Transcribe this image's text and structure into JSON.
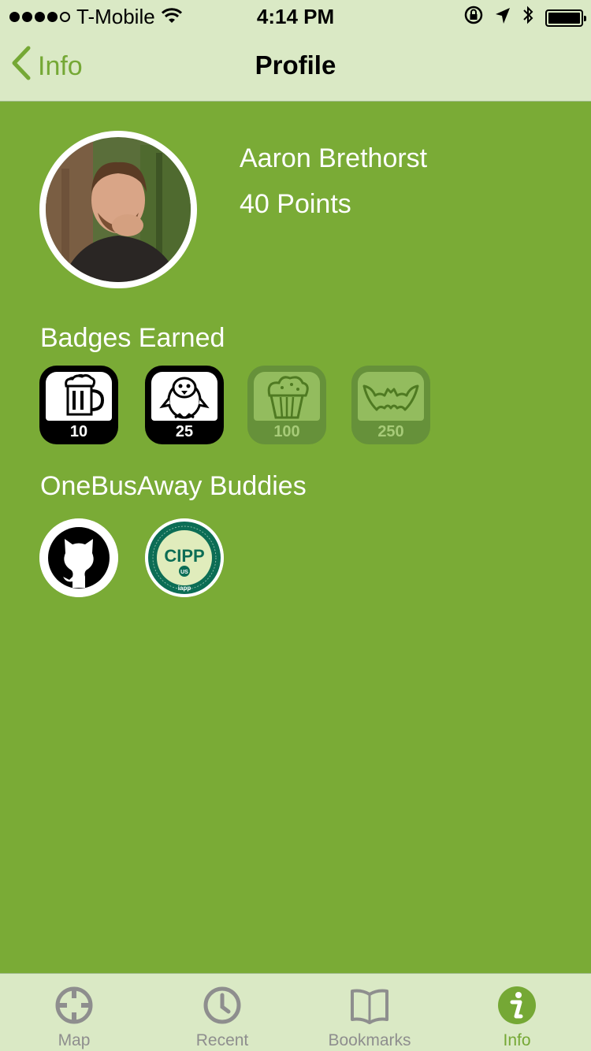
{
  "status_bar": {
    "carrier": "T-Mobile",
    "time": "4:14 PM",
    "signal_bars_filled": 4,
    "signal_bars_total": 5,
    "battery_level_percent": 100
  },
  "nav": {
    "back_label": "Info",
    "title": "Profile"
  },
  "profile": {
    "name": "Aaron Brethorst",
    "points": "40 Points"
  },
  "badges": {
    "heading": "Badges Earned",
    "items": [
      {
        "icon": "beer-mug-icon",
        "count": "10",
        "earned": true
      },
      {
        "icon": "penguin-icon",
        "count": "25",
        "earned": true
      },
      {
        "icon": "muffin-icon",
        "count": "100",
        "earned": false
      },
      {
        "icon": "bat-icon",
        "count": "250",
        "earned": false
      }
    ]
  },
  "buddies": {
    "heading": "OneBusAway Buddies",
    "items": [
      {
        "icon": "github-octocat-icon"
      },
      {
        "icon": "cipp-us-seal-icon",
        "seal_text": "CIPP",
        "seal_sub": "US",
        "seal_org": "iapp",
        "seal_ring": "Certified Information Privacy Professional | United States"
      }
    ]
  },
  "tabs": [
    {
      "label": "Map",
      "icon": "map-crosshair-icon",
      "active": false
    },
    {
      "label": "Recent",
      "icon": "clock-icon",
      "active": false
    },
    {
      "label": "Bookmarks",
      "icon": "book-icon",
      "active": false
    },
    {
      "label": "Info",
      "icon": "info-icon",
      "active": true
    }
  ],
  "colors": {
    "background": "#7aab36",
    "chrome": "#dae9c5",
    "accent": "#75a835",
    "tab_inactive": "#8e8e8e"
  }
}
